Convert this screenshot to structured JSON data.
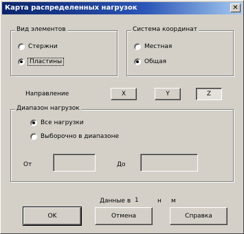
{
  "window": {
    "title": "Карта распределенных нагрузок",
    "close_glyph": "✕"
  },
  "element_type": {
    "legend": "Вид элементов",
    "options": [
      {
        "label": "Стержни",
        "checked": false
      },
      {
        "label": "Пластины",
        "checked": true
      }
    ]
  },
  "coord_system": {
    "legend": "Система координат",
    "options": [
      {
        "label": "Местная",
        "checked": false
      },
      {
        "label": "Общая",
        "checked": true
      }
    ]
  },
  "direction": {
    "label": "Направление",
    "buttons": [
      {
        "label": "X",
        "pressed": false
      },
      {
        "label": "Y",
        "pressed": false
      },
      {
        "label": "Z",
        "pressed": true
      }
    ]
  },
  "load_range": {
    "legend": "Диапазон нагрузок",
    "options": [
      {
        "label": "Все нагрузки",
        "checked": true
      },
      {
        "label": "Выборочно в диапазоне",
        "checked": false
      }
    ],
    "from_label": "От",
    "from_value": "",
    "to_label": "До",
    "to_value": ""
  },
  "units": {
    "label": "Данные в",
    "value": "1",
    "unit1": "н",
    "unit2": "м"
  },
  "buttons": {
    "ok": "OK",
    "cancel": "Отмена",
    "help": "Справка"
  }
}
